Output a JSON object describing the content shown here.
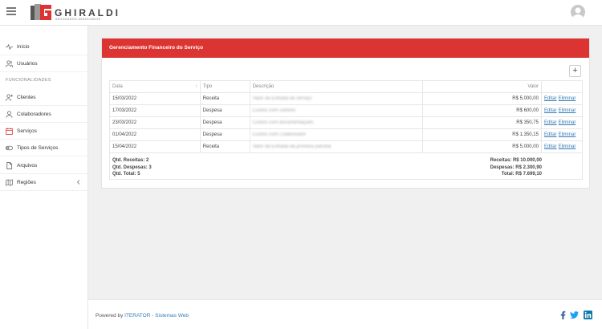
{
  "header": {
    "logo_name": "GHIRALDI",
    "logo_sub": "ADVOGADOS ASSOCIADOS"
  },
  "sidebar": {
    "items": [
      {
        "label": "Início",
        "icon": "activity-icon"
      },
      {
        "label": "Usuários",
        "icon": "users-icon"
      },
      {
        "label": "Clientes",
        "icon": "user-plus-icon"
      },
      {
        "label": "Colaboradores",
        "icon": "user-icon"
      },
      {
        "label": "Serviços",
        "icon": "calendar-icon"
      },
      {
        "label": "Tipos de Serviços",
        "icon": "toggle-icon"
      },
      {
        "label": "Arquivos",
        "icon": "file-icon"
      },
      {
        "label": "Regiões",
        "icon": "map-icon"
      }
    ],
    "section_label": "FUNCIONALIDADES"
  },
  "card": {
    "title": "Gerenciamento Financeiro do Serviço",
    "add_label": "+"
  },
  "table": {
    "headers": [
      "Data",
      "Tipo",
      "Descrição",
      "Valor",
      ""
    ],
    "rows": [
      {
        "date": "15/03/2022",
        "type": "Receita",
        "desc": "Valor da Entrada do serviço",
        "value": "R$ 5.000,00"
      },
      {
        "date": "17/03/2022",
        "type": "Despesa",
        "desc": "Custos com cartório",
        "value": "R$ 600,00"
      },
      {
        "date": "23/03/2022",
        "type": "Despesa",
        "desc": "Custos com documentações",
        "value": "R$ 350,75"
      },
      {
        "date": "01/04/2022",
        "type": "Despesa",
        "desc": "Custos com Colaborador",
        "value": "R$ 1.350,15"
      },
      {
        "date": "15/04/2022",
        "type": "Receita",
        "desc": "Valor da Entrada da primeira parcela",
        "value": "R$ 5.000,00"
      }
    ],
    "edit_label": "Editar",
    "delete_label": "Eliminar"
  },
  "summary": {
    "qtd_receitas": "Qtd. Receitas: 2",
    "qtd_despesas": "Qtd. Despesas: 3",
    "qtd_total": "Qtd. Total: 5",
    "receitas": "Receitas: R$ 10.000,00",
    "despesas": "Despesas: R$ 2.300,90",
    "total": "Total: R$ 7.699,10"
  },
  "footer": {
    "powered_prefix": "Powered by ",
    "powered_brand": "ITERATOR - Sistemas Web"
  },
  "colors": {
    "accent": "#dc3432",
    "link": "#337ab7"
  }
}
